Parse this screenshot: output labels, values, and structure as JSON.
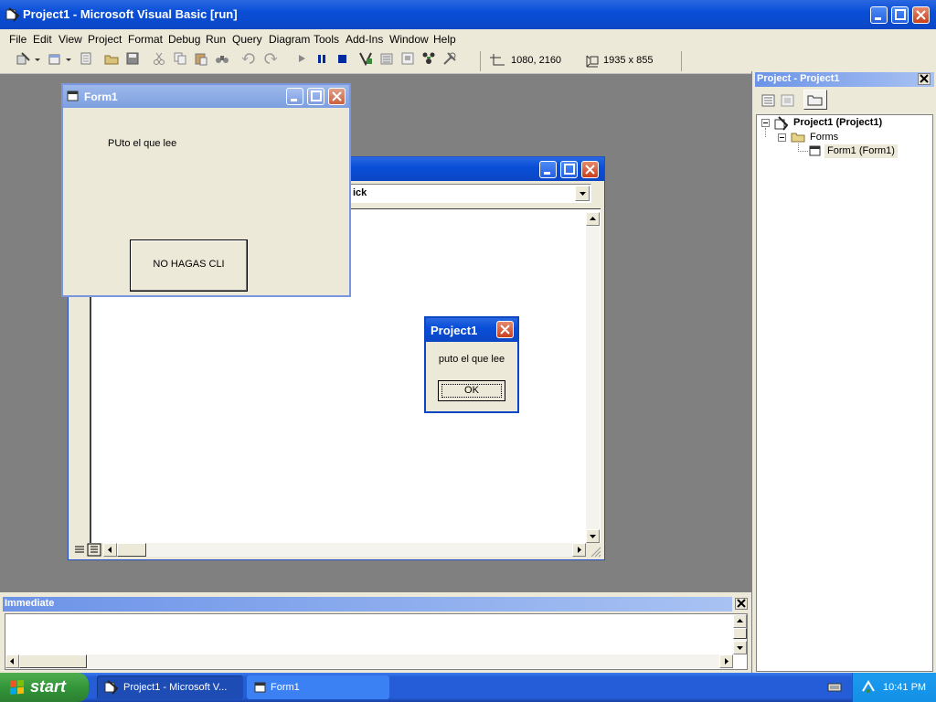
{
  "app": {
    "title": "Project1 - Microsoft Visual Basic [run]"
  },
  "menu": [
    "File",
    "Edit",
    "View",
    "Project",
    "Format",
    "Debug",
    "Run",
    "Query",
    "Diagram",
    "Tools",
    "Add-Ins",
    "Window",
    "Help"
  ],
  "toolbar": {
    "position_readout": "1080, 2160",
    "size_readout": "1935 x 855"
  },
  "code_window": {
    "proc_combo": "ick"
  },
  "form1": {
    "title": "Form1",
    "label": "PUto el que lee",
    "button": "NO HAGAS CLI"
  },
  "msgbox": {
    "title": "Project1",
    "message": "puto el que lee",
    "ok": "OK"
  },
  "project_panel": {
    "title": "Project - Project1",
    "tree": {
      "root": "Project1 (Project1)",
      "folder": "Forms",
      "item": "Form1 (Form1)"
    }
  },
  "immediate": {
    "title": "Immediate"
  },
  "taskbar": {
    "start": "start",
    "tasks": [
      "Project1 - Microsoft V...",
      "Form1"
    ],
    "clock": "10:41 PM"
  }
}
